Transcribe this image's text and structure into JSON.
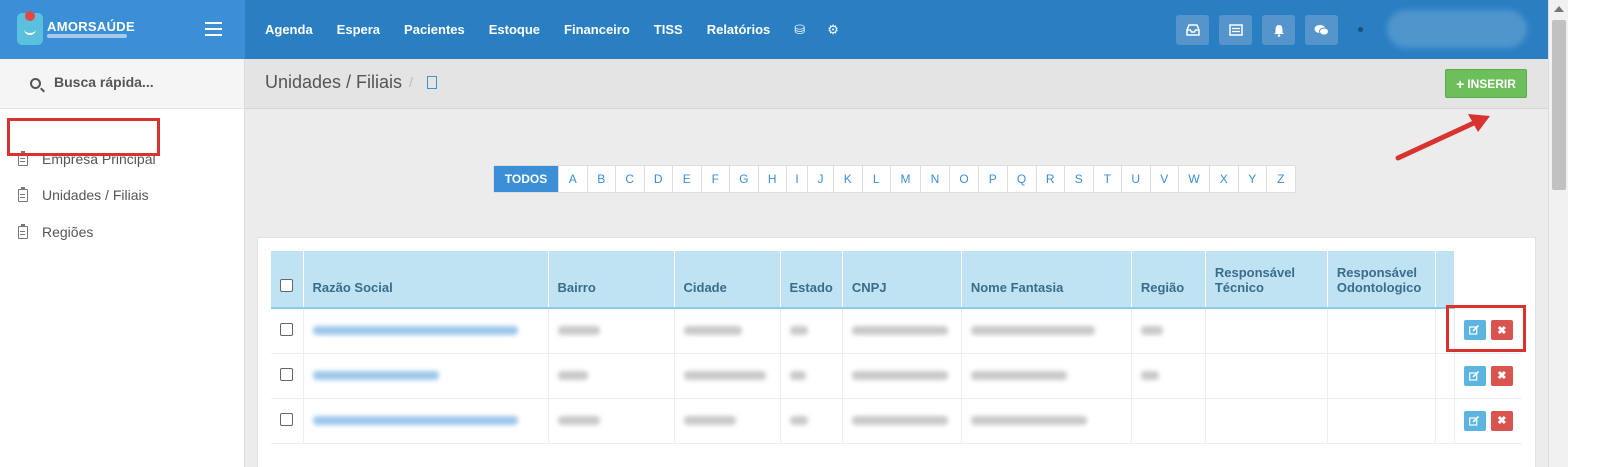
{
  "brand": {
    "name": "AMORSAÚDE"
  },
  "nav": {
    "items": [
      "Agenda",
      "Espera",
      "Pacientes",
      "Estoque",
      "Financeiro",
      "TISS",
      "Relatórios"
    ],
    "icons": [
      "database-icon",
      "gear-icon"
    ]
  },
  "toolbar_icons": [
    "inbox-icon",
    "list-icon",
    "bell-icon",
    "chat-icon"
  ],
  "sidebar": {
    "search_placeholder": "Busca rápida...",
    "items": [
      {
        "label": "Empresa Principal"
      },
      {
        "label": "Unidades / Filiais"
      },
      {
        "label": "Regiões"
      }
    ]
  },
  "header": {
    "title": "Unidades / Filiais",
    "separator": "/",
    "insert_label": "INSERIR"
  },
  "alphabet": [
    "TODOS",
    "A",
    "B",
    "C",
    "D",
    "E",
    "F",
    "G",
    "H",
    "I",
    "J",
    "K",
    "L",
    "M",
    "N",
    "O",
    "P",
    "Q",
    "R",
    "S",
    "T",
    "U",
    "V",
    "W",
    "X",
    "Y",
    "Z"
  ],
  "table": {
    "columns": [
      "Razão Social",
      "Bairro",
      "Cidade",
      "Estado",
      "CNPJ",
      "Nome Fantasia",
      "Região",
      "Responsável Técnico",
      "Responsável Odontologico"
    ]
  },
  "colors": {
    "topbar": "#2a7fc3",
    "accent": "#3a8fd6",
    "insert": "#6cbf5b",
    "delete": "#d9534f",
    "highlight": "#d9332f"
  }
}
